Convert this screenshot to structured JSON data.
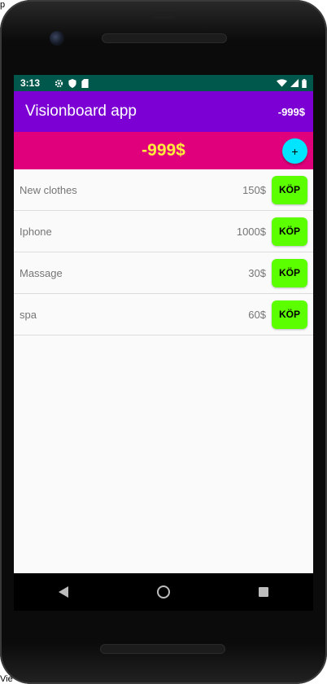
{
  "status_bar": {
    "time": "3:13",
    "icons": [
      "gear-icon",
      "shield-icon",
      "sdcard-icon"
    ],
    "right_icons": [
      "wifi-icon",
      "signal-icon",
      "battery-icon"
    ]
  },
  "app_bar": {
    "title": "Visionboard app",
    "balance": "-999$"
  },
  "banner": {
    "balance": "-999$",
    "add_label": "+"
  },
  "items": [
    {
      "name": "New clothes",
      "price": "150$",
      "buy_label": "KÖP"
    },
    {
      "name": "Iphone",
      "price": "1000$",
      "buy_label": "KÖP"
    },
    {
      "name": "Massage",
      "price": "30$",
      "buy_label": "KÖP"
    },
    {
      "name": "spa",
      "price": "60$",
      "buy_label": "KÖP"
    }
  ],
  "colors": {
    "status_bar": "#00574b",
    "app_bar": "#7c00d4",
    "banner": "#e1007c",
    "balance_text": "#ffeb3b",
    "fab": "#00e5ff",
    "buy_button": "#5cff00"
  },
  "edge_text": {
    "top": "p",
    "bottom": "Vie"
  }
}
